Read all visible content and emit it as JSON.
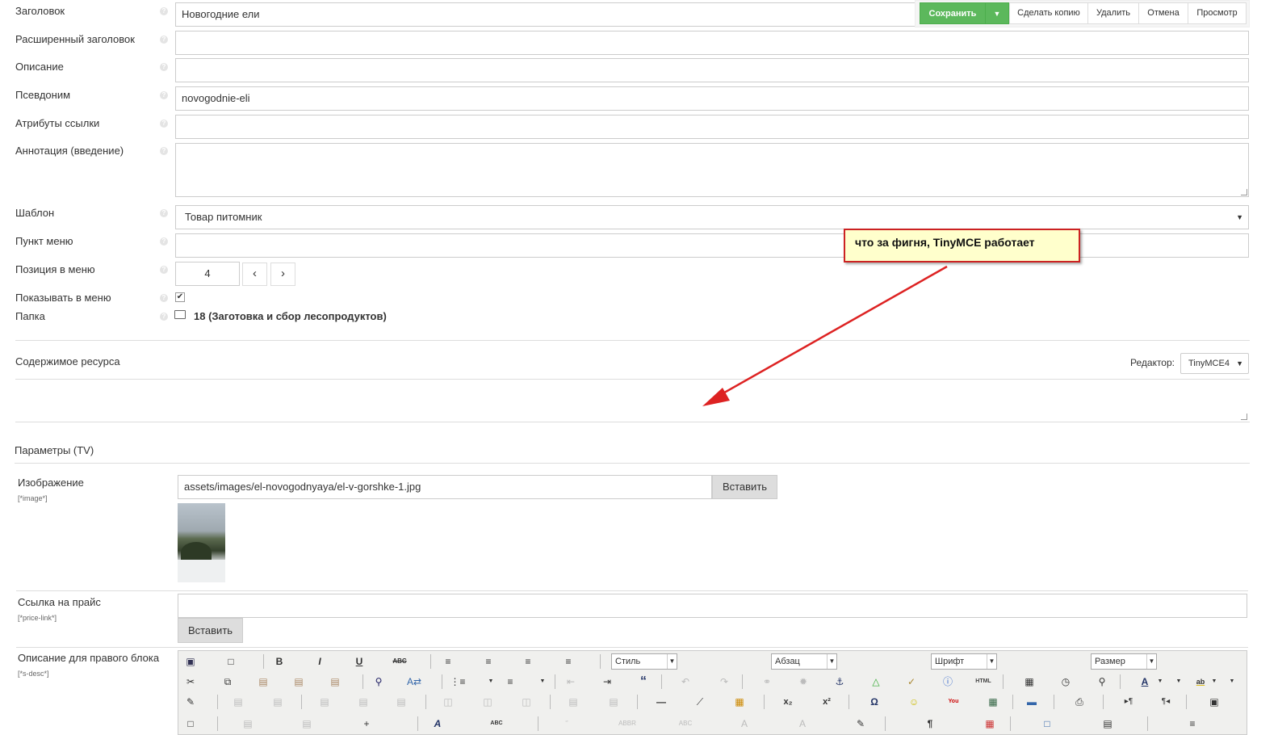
{
  "fields": {
    "title": {
      "label": "Заголовок",
      "value": "Новогодние ели"
    },
    "longtitle": {
      "label": "Расширенный заголовок",
      "value": ""
    },
    "description": {
      "label": "Описание",
      "value": ""
    },
    "alias": {
      "label": "Псевдоним",
      "value": "novogodnie-eli"
    },
    "link_attrs": {
      "label": "Атрибуты ссылки",
      "value": ""
    },
    "introtext": {
      "label": "Аннотация (введение)",
      "value": ""
    },
    "template": {
      "label": "Шаблон",
      "value": "Товар питомник"
    },
    "menutitle": {
      "label": "Пункт меню",
      "value": ""
    },
    "menuindex": {
      "label": "Позиция в меню",
      "value": "4",
      "prev": "‹",
      "next": "›"
    },
    "hidemenu": {
      "label": "Показывать в меню",
      "checked": true
    },
    "parent": {
      "label": "Папка",
      "value": "18 (Заготовка и сбор лесопродуктов)"
    }
  },
  "toolbar": {
    "save": "Сохранить",
    "duplicate": "Сделать копию",
    "delete": "Удалить",
    "cancel": "Отмена",
    "preview": "Просмотр"
  },
  "content": {
    "label": "Содержимое ресурса",
    "editor_label": "Редактор:",
    "editor_value": "TinyMCE4"
  },
  "annotation": {
    "text": "что за фигня, TinyMCE работает",
    "bg_color": "#ffffcc",
    "border_color": "#cc2222",
    "arrow_color": "#dd2222"
  },
  "tv": {
    "section_title": "Параметры (TV)",
    "image": {
      "label": "Изображение",
      "name": "[*image*]",
      "value": "assets/images/el-novogodnyaya/el-v-gorshke-1.jpg",
      "button": "Вставить"
    },
    "price_link": {
      "label": "Ссылка на прайс",
      "name": "[*price-link*]",
      "value": "",
      "button": "Вставить"
    },
    "s_desc": {
      "label": "Описание для правого блока",
      "name": "[*s-desc*]"
    }
  },
  "editor_toolbar": {
    "style": "Стиль",
    "format": "Абзац",
    "font": "Шрифт",
    "size": "Размер"
  },
  "colors": {
    "save_green": "#5cb85c",
    "save_green_dark": "#4cae4c"
  }
}
